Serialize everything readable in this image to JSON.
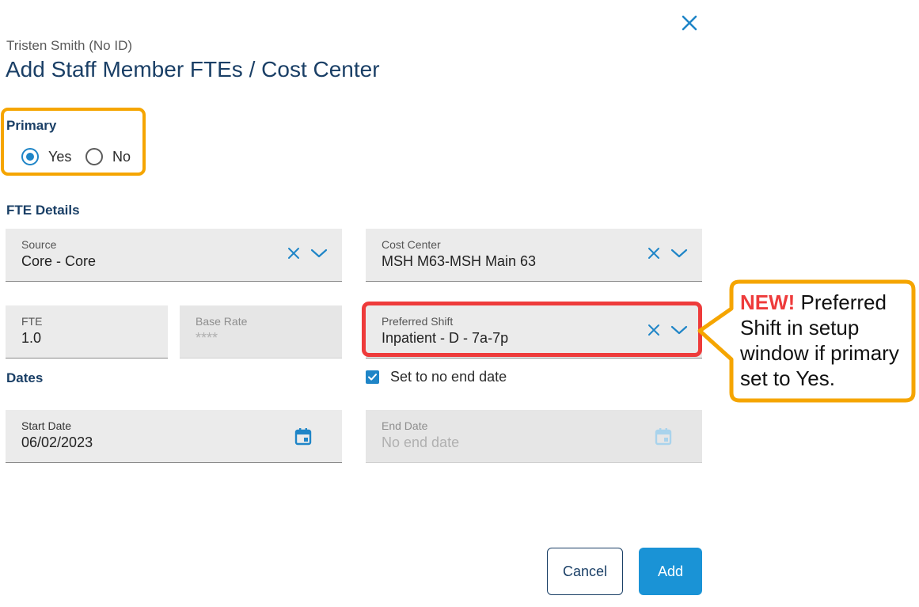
{
  "header": {
    "subtitle": "Tristen Smith (No ID)",
    "title": "Add Staff Member FTEs / Cost Center",
    "close_icon": "close-icon"
  },
  "primary": {
    "label": "Primary",
    "options": [
      {
        "label": "Yes",
        "selected": true
      },
      {
        "label": "No",
        "selected": false
      }
    ]
  },
  "fte_details": {
    "label": "FTE Details",
    "source": {
      "label": "Source",
      "value": "Core - Core"
    },
    "cost_center": {
      "label": "Cost Center",
      "value": "MSH M63-MSH Main 63"
    },
    "fte": {
      "label": "FTE",
      "value": "1.0"
    },
    "base_rate": {
      "label": "Base Rate",
      "value": "****"
    },
    "preferred_shift": {
      "label": "Preferred Shift",
      "value": "Inpatient - D - 7a-7p"
    }
  },
  "dates": {
    "label": "Dates",
    "no_end_date_checkbox": {
      "label": "Set to no end date",
      "checked": true
    },
    "start_date": {
      "label": "Start Date",
      "value": "06/02/2023"
    },
    "end_date": {
      "label": "End Date",
      "placeholder": "No end date"
    }
  },
  "footer": {
    "cancel_label": "Cancel",
    "add_label": "Add"
  },
  "annotation": {
    "highlight": "NEW!",
    "text": " Preferred Shift in setup window if primary set to Yes."
  },
  "colors": {
    "accent": "#1f85c7",
    "title": "#1a3f66",
    "primary_highlight": "#f5a500",
    "shift_highlight": "#ee3b3b",
    "add_button": "#1a93d6"
  }
}
